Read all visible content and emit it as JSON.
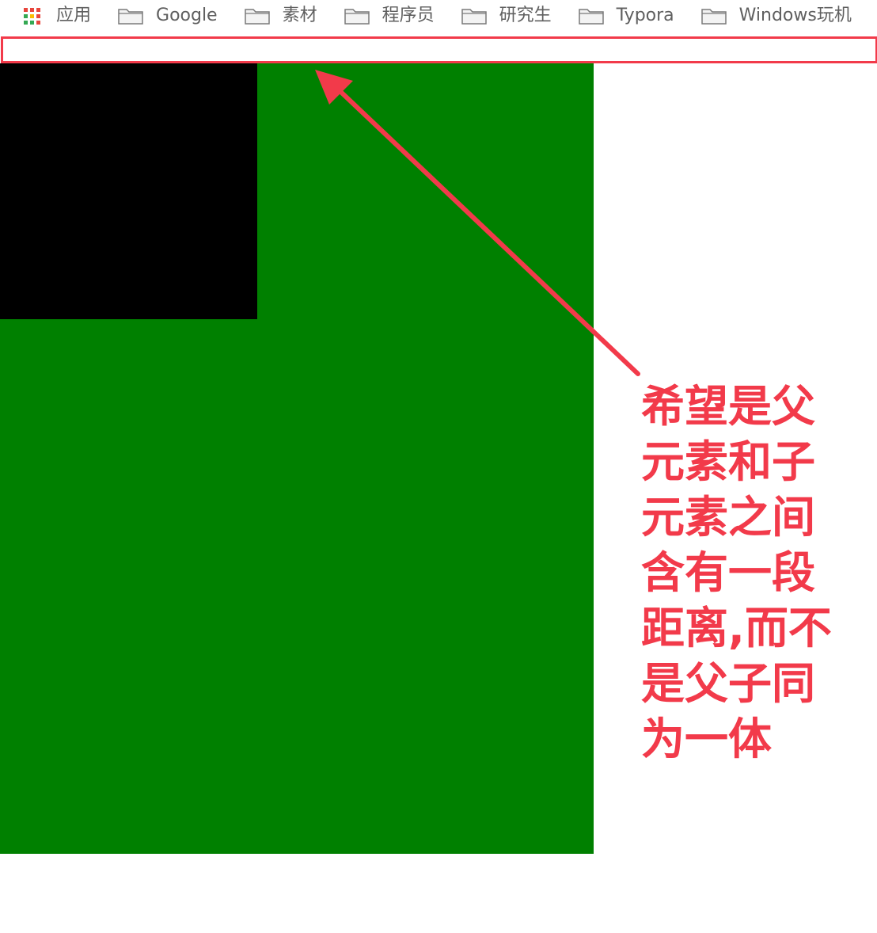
{
  "bookmarks_bar": {
    "apps_label": "应用",
    "items": [
      {
        "label": "Google"
      },
      {
        "label": "素材"
      },
      {
        "label": "程序员"
      },
      {
        "label": "研究生"
      },
      {
        "label": "Typora"
      },
      {
        "label": "Windows玩机"
      }
    ]
  },
  "annotation": {
    "text": "希望是父\n元素和子\n元素之间\n含有一段\n距离,而不\n是父子同\n为一体",
    "color": "#f23a4a"
  },
  "colors": {
    "parent_box": "#008000",
    "child_box": "#000000",
    "background": "#ffffff"
  },
  "icons": {
    "apps": "apps-grid-icon",
    "folder": "folder-icon"
  }
}
